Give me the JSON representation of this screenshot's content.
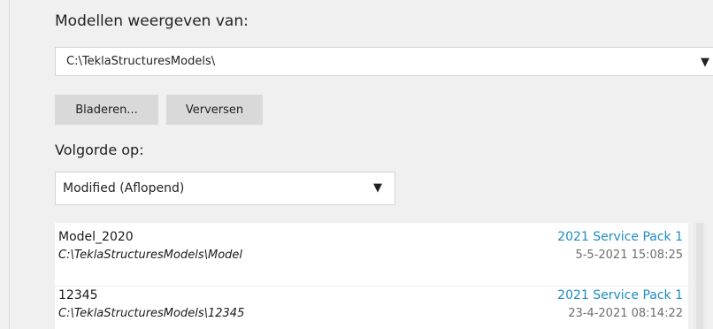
{
  "models_location": {
    "label": "Modellen weergeven van:",
    "selected_path": "C:\\TeklaStructuresModels\\",
    "arrow_icon": "▼"
  },
  "buttons": {
    "browse_label": "Bladeren...",
    "refresh_label": "Verversen"
  },
  "sort": {
    "label": "Volgorde op:",
    "selected": "Modified (Aflopend)",
    "arrow_icon": "▼"
  },
  "models": [
    {
      "name": "Model_2020",
      "path": "C:\\TeklaStructuresModels\\Model",
      "version": "2021 Service Pack 1",
      "modified": "5-5-2021 15:08:25"
    },
    {
      "name": "12345",
      "path": "C:\\TeklaStructuresModels\\12345",
      "version": "2021 Service Pack 1",
      "modified": "23-4-2021 08:14:22"
    }
  ],
  "colors": {
    "background": "#f0f0f0",
    "version_text": "#1e8bc3",
    "date_text": "#6d6d6d",
    "button_bg": "#d9d9d9"
  }
}
